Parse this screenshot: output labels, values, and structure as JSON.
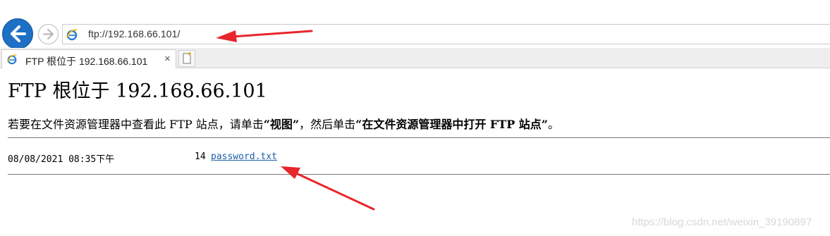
{
  "browser": {
    "address": "ftp://192.168.66.101/",
    "tab_title": "FTP 根位于 192.168.66.101",
    "tab_close": "×",
    "colors": {
      "back_button": "#1e6fc6",
      "link": "#1a5ea8",
      "arrow": "#e8262b"
    }
  },
  "page": {
    "heading": "FTP 根位于 192.168.66.101",
    "instruction": {
      "prefix": "若要在文件资源管理器中查看此 FTP 站点，请单击",
      "view": "“视图”",
      "middle": "，然后单击",
      "open": "“在文件资源管理器中打开 FTP 站点”",
      "suffix": "。"
    },
    "listing": [
      {
        "date": "08/08/2021 08:35下午",
        "size": "14",
        "name": "password.txt"
      }
    ]
  },
  "watermark": "https://blog.csdn.net/weixin_39190897",
  "icons": [
    "back-arrow-icon",
    "forward-arrow-icon",
    "ie-logo-icon",
    "new-tab-icon"
  ]
}
